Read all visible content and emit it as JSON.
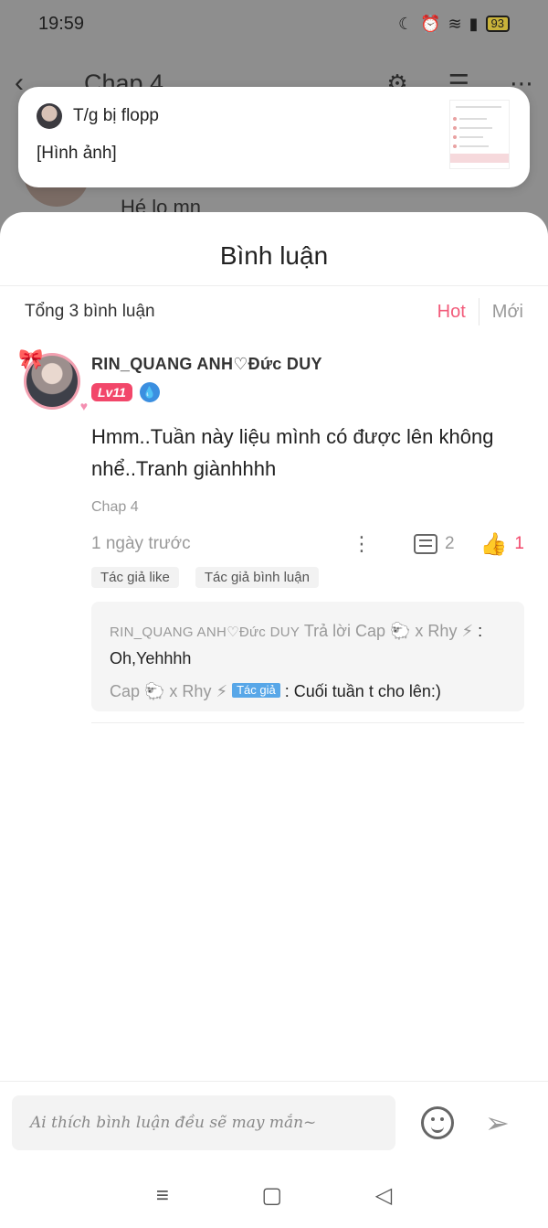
{
  "status_bar": {
    "time": "19:59",
    "battery": "93"
  },
  "background_page": {
    "title": "Chap 4",
    "preview_text": "Hé lo mn"
  },
  "notification": {
    "title": "T/g bị flopp",
    "body": "[Hình ảnh]"
  },
  "sheet": {
    "title": "Bình luận",
    "total": "Tổng 3 bình luận",
    "sort_hot": "Hot",
    "sort_new": "Mới"
  },
  "comment": {
    "username": "RIN_QUANG ANH♡Đức DUY",
    "level": "Lv11",
    "text": "Hmm..Tuần này liệu mình có được lên không nhể..Tranh giànhhhh",
    "chapter": "Chap 4",
    "time_ago": "1 ngày trước",
    "reply_count": "2",
    "like_count": "1",
    "tags": [
      "Tác giả like",
      "Tác giả bình luận"
    ],
    "replies": {
      "r1_user": "RIN_QUANG ANH♡Đức DUY",
      "r1_action": "Trả lời",
      "r1_target": "Cap 🐑 x Rhy ⚡",
      "r1_text": ": Oh,Yehhhh",
      "r2_user": "Cap 🐑 x Rhy ⚡",
      "r2_badge": "Tác giả",
      "r2_text": ": Cuối tuần t cho lên:)"
    }
  },
  "input": {
    "placeholder": "Ai thích bình luận đều sẽ may mắn~"
  },
  "colors": {
    "accent": "#f2476a",
    "author_badge": "#58a7e8"
  }
}
